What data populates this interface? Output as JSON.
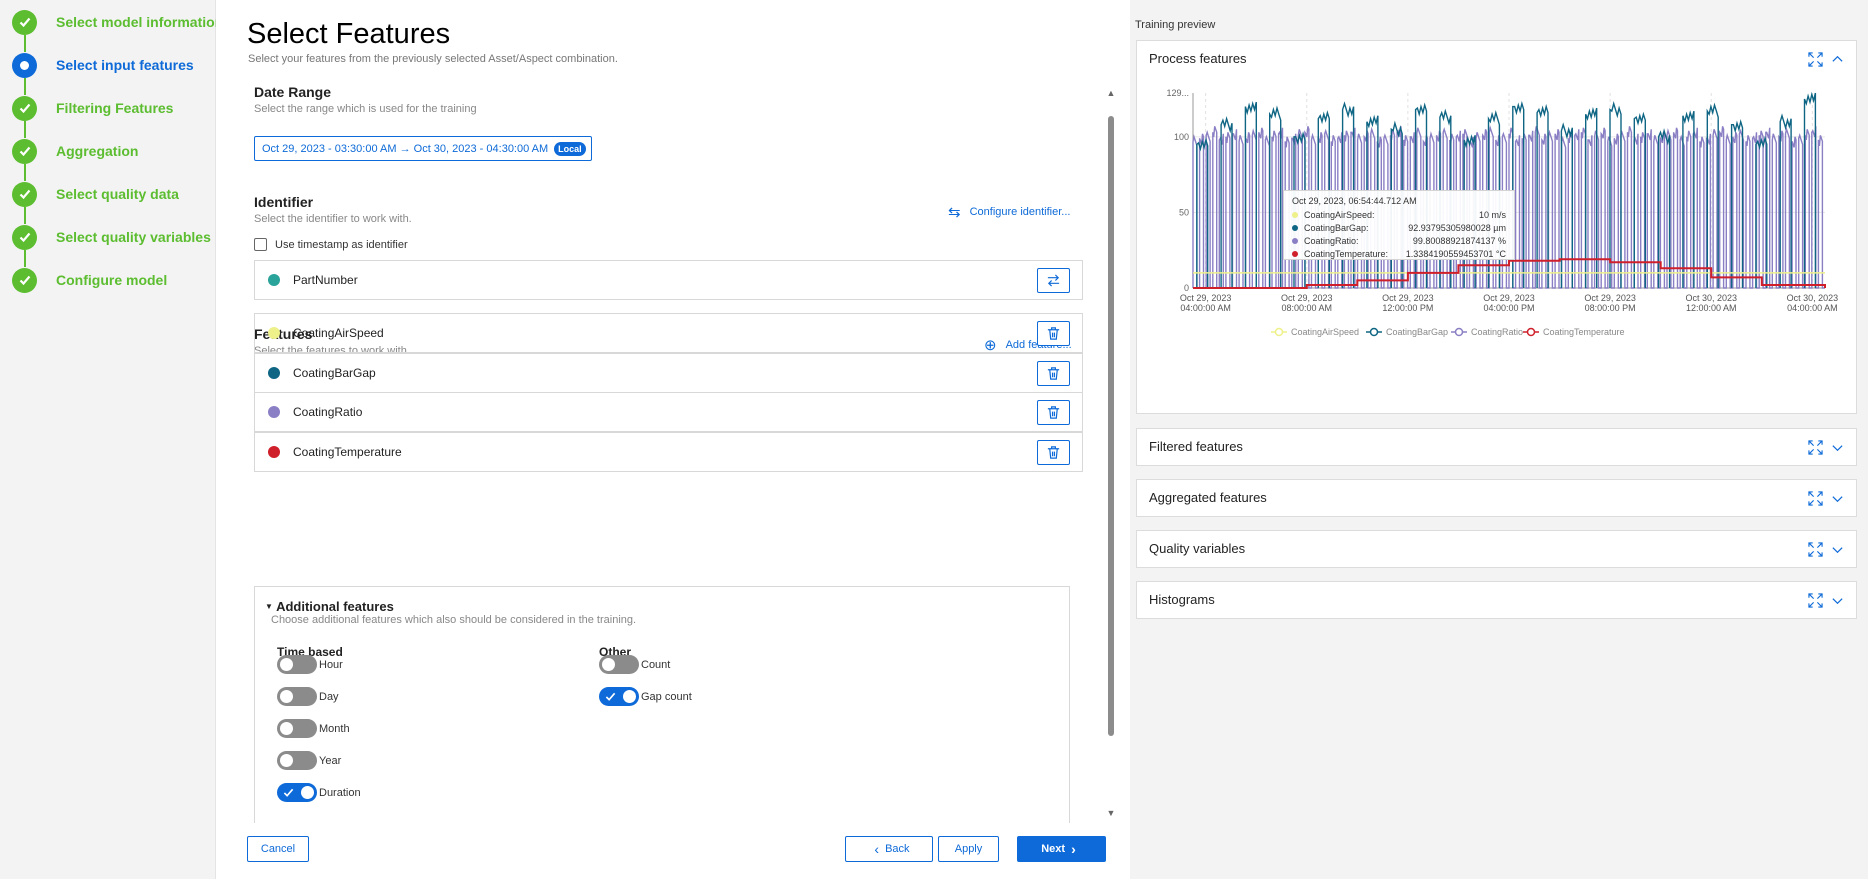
{
  "stepper": {
    "steps": [
      {
        "label": "Select model information",
        "state": "done"
      },
      {
        "label": "Select input features",
        "state": "active"
      },
      {
        "label": "Filtering Features",
        "state": "done"
      },
      {
        "label": "Aggregation",
        "state": "done"
      },
      {
        "label": "Select quality data",
        "state": "done"
      },
      {
        "label": "Select quality variables",
        "state": "done"
      },
      {
        "label": "Configure model",
        "state": "done"
      }
    ]
  },
  "page": {
    "title": "Select Features",
    "subtitle": "Select your features from the previously selected Asset/Aspect combination."
  },
  "date_range": {
    "title": "Date Range",
    "subtitle": "Select the range which is used for the training",
    "value": "Oct 29, 2023 - 03:30:00 AM → Oct 30, 2023 - 04:30:00 AM",
    "badge": "Local"
  },
  "identifier": {
    "title": "Identifier",
    "subtitle": "Select the identifier to work with.",
    "configure_label": "Configure identifier...",
    "checkbox_label": "Use timestamp as identifier",
    "checkbox_checked": false,
    "item": {
      "name": "PartNumber",
      "color": "#2aa39b"
    }
  },
  "features": {
    "title": "Features",
    "subtitle": "Select the features to work with.",
    "add_label": "Add feature...",
    "items": [
      {
        "name": "CoatingAirSpeed",
        "color": "#eef08a"
      },
      {
        "name": "CoatingBarGap",
        "color": "#0f6684"
      },
      {
        "name": "CoatingRatio",
        "color": "#8a7fc4"
      },
      {
        "name": "CoatingTemperature",
        "color": "#cf1f2a"
      }
    ]
  },
  "additional": {
    "title": "Additional features",
    "subtitle": "Choose additional features which also should be considered in the training.",
    "time_based": {
      "title": "Time based",
      "toggles": [
        {
          "label": "Hour",
          "on": false
        },
        {
          "label": "Day",
          "on": false
        },
        {
          "label": "Month",
          "on": false
        },
        {
          "label": "Year",
          "on": false
        },
        {
          "label": "Duration",
          "on": true
        }
      ]
    },
    "other": {
      "title": "Other",
      "toggles": [
        {
          "label": "Count",
          "on": false
        },
        {
          "label": "Gap count",
          "on": true
        }
      ]
    }
  },
  "footer": {
    "cancel": "Cancel",
    "back": "Back",
    "apply": "Apply",
    "next": "Next"
  },
  "preview": {
    "label": "Training preview",
    "panels": [
      {
        "title": "Process features",
        "expanded": true
      },
      {
        "title": "Filtered features",
        "expanded": false
      },
      {
        "title": "Aggregated features",
        "expanded": false
      },
      {
        "title": "Quality variables",
        "expanded": false
      },
      {
        "title": "Histograms",
        "expanded": false
      }
    ],
    "tooltip": {
      "time": "Oct 29, 2023, 06:54:44.712 AM",
      "rows": [
        {
          "name": "CoatingAirSpeed:",
          "value": "10 m/s",
          "color": "#eef08a"
        },
        {
          "name": "CoatingBarGap:",
          "value": "92.93795305980028 µm",
          "color": "#0f6684"
        },
        {
          "name": "CoatingRatio:",
          "value": "99.80088921874137 %",
          "color": "#8a7fc4"
        },
        {
          "name": "CoatingTemperature:",
          "value": "1.3384190559453701 °C",
          "color": "#cf1f2a"
        }
      ]
    }
  },
  "chart_data": {
    "type": "line",
    "title": "",
    "xlabel": "",
    "ylabel": "",
    "ylim": [
      0,
      129
    ],
    "y_ticks": [
      "0",
      "50",
      "100",
      "129..."
    ],
    "x_ticks": [
      [
        "Oct 29, 2023",
        "04:00:00 AM"
      ],
      [
        "Oct 29, 2023",
        "08:00:00 AM"
      ],
      [
        "Oct 29, 2023",
        "12:00:00 PM"
      ],
      [
        "Oct 29, 2023",
        "04:00:00 PM"
      ],
      [
        "Oct 29, 2023",
        "08:00:00 PM"
      ],
      [
        "Oct 30, 2023",
        "12:00:00 AM"
      ],
      [
        "Oct 30, 2023",
        "04:00:00 AM"
      ]
    ],
    "x_hours": [
      0,
      4,
      8,
      12,
      16,
      20,
      24
    ],
    "x_range_hours": [
      -0.5,
      24.5
    ],
    "legend_position": "bottom",
    "series": [
      {
        "name": "CoatingAirSpeed",
        "color": "#eef08a",
        "x_hours": [
          -0.5,
          24.5
        ],
        "values": [
          10,
          10
        ]
      },
      {
        "name": "CoatingBarGap",
        "color": "#0f6684",
        "pattern": "square wave between ~0 and ~95-125",
        "x_hours": [
          -0.5,
          0.5,
          1.5,
          2.5,
          3.5,
          4.5,
          5.5,
          6.5,
          7.5,
          8.5,
          9.5,
          10.5,
          11.5,
          12.5,
          13.5,
          14.5,
          15.5,
          16.5,
          17.5,
          18.5,
          19.5,
          20.5,
          21.5,
          22.5,
          23.5,
          24.5
        ],
        "values": [
          95,
          108,
          120,
          115,
          100,
          112,
          118,
          110,
          105,
          118,
          113,
          98,
          112,
          120,
          116,
          104,
          115,
          118,
          112,
          100,
          114,
          117,
          108,
          95,
          110,
          125
        ]
      },
      {
        "name": "CoatingRatio",
        "color": "#8a7fc4",
        "pattern": "square wave between ~0 and ~100",
        "x_hours": [
          -0.5,
          24.5
        ],
        "values": [
          100,
          100
        ]
      },
      {
        "name": "CoatingTemperature",
        "color": "#cf1f2a",
        "x_hours": [
          -0.5,
          2,
          4,
          6,
          8,
          10,
          12,
          14,
          16,
          18,
          20,
          22,
          24.5
        ],
        "values": [
          0,
          0,
          2,
          5,
          10,
          15,
          18,
          19,
          17,
          13,
          7,
          2,
          0
        ]
      }
    ]
  }
}
